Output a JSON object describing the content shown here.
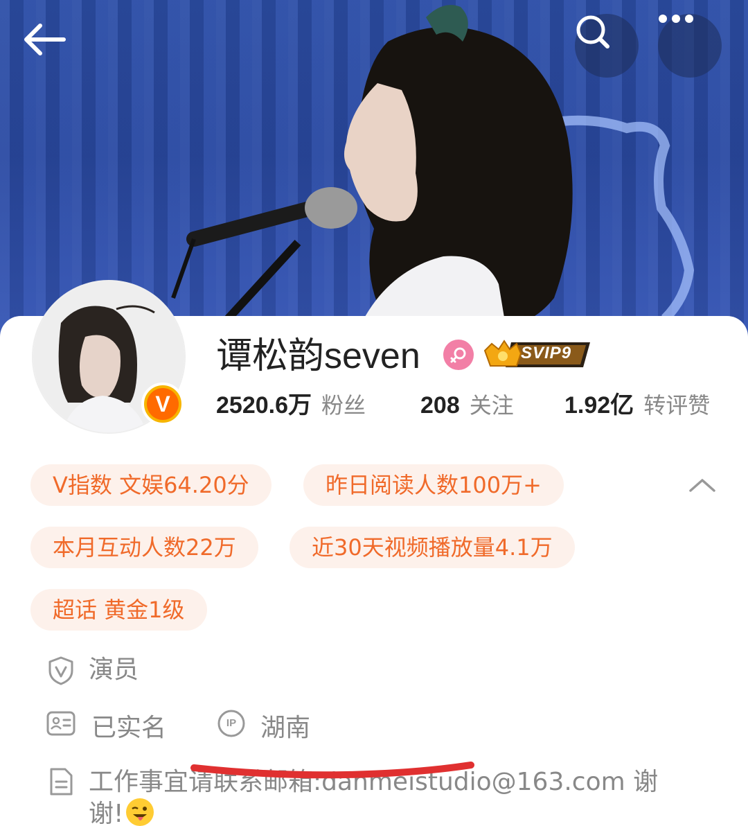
{
  "header": {
    "back_icon": "arrow-left-icon",
    "search_icon": "search-icon",
    "more_icon": "more-dots-icon"
  },
  "profile": {
    "name": "谭松韵seven",
    "gender_icon": "female-icon",
    "vip_label": "SVIP9",
    "verified_icon": "verified-v-icon",
    "verified_letter": "V"
  },
  "stats": [
    {
      "value": "2520.6万",
      "label": "粉丝"
    },
    {
      "value": "208",
      "label": "关注"
    },
    {
      "value": "1.92亿",
      "label": "转评赞"
    }
  ],
  "tags": [
    "V指数 文娱64.20分",
    "昨日阅读人数100万+",
    "本月互动人数22万",
    "近30天视频播放量4.1万",
    "超话 黄金1级"
  ],
  "info": {
    "occupation": "演员",
    "verified_name": "已实名",
    "ip_badge": "IP",
    "ip_location": "湖南",
    "description": "工作事宜请联系邮箱:danmeistudio@163.com 谢谢!"
  },
  "colors": {
    "accent_orange": "#f06a2a",
    "tag_background": "#fdf1eb",
    "vip_gold": "#f3a712",
    "gender_pink": "#f27fa6",
    "annotation_red": "#e03030"
  }
}
